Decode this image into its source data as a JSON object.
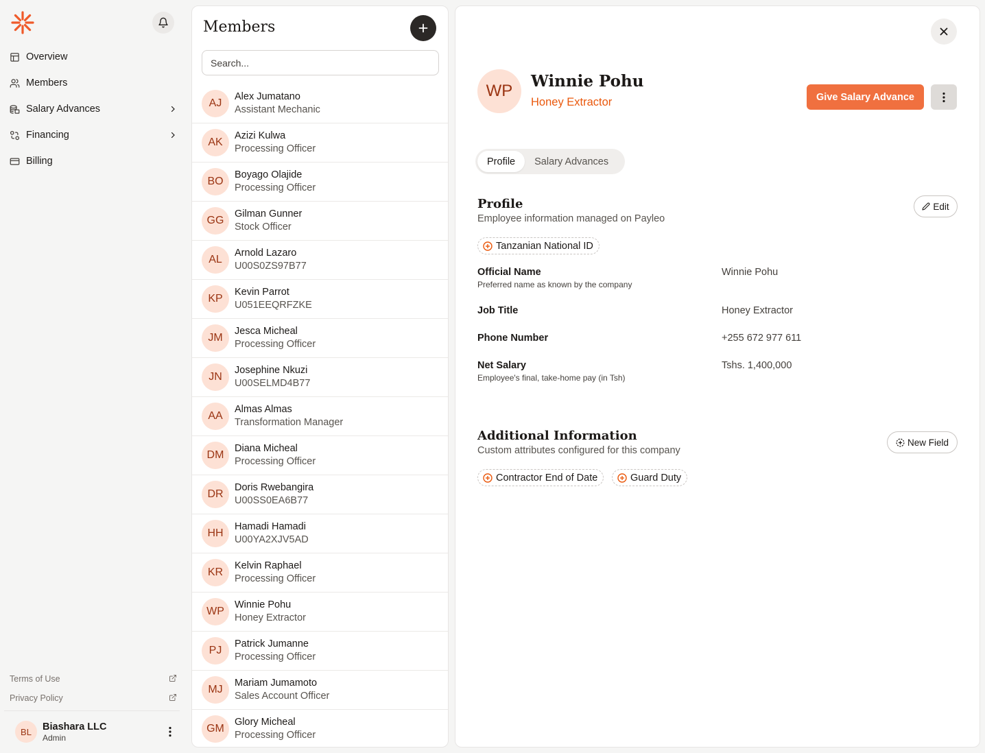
{
  "colors": {
    "accent": "#f0703f",
    "accent_text": "#ea580c",
    "avatar_bg": "#fde1d5",
    "avatar_text": "#9a3412"
  },
  "sidebar": {
    "logo_icon": "asterisk-logo-icon",
    "items": [
      {
        "label": "Overview",
        "icon": "layout-icon",
        "has_chevron": false
      },
      {
        "label": "Members",
        "icon": "users-icon",
        "has_chevron": false
      },
      {
        "label": "Salary Advances",
        "icon": "coins-icon",
        "has_chevron": true
      },
      {
        "label": "Financing",
        "icon": "cycle-icon",
        "has_chevron": true
      },
      {
        "label": "Billing",
        "icon": "credit-card-icon",
        "has_chevron": false
      }
    ],
    "footer_links": [
      {
        "label": "Terms of Use"
      },
      {
        "label": "Privacy Policy"
      }
    ],
    "account": {
      "initials": "BL",
      "name": "Biashara LLC",
      "role": "Admin"
    }
  },
  "members_panel": {
    "title": "Members",
    "search_placeholder": "Search...",
    "members": [
      {
        "initials": "AJ",
        "name": "Alex Jumatano",
        "role": "Assistant Mechanic"
      },
      {
        "initials": "AK",
        "name": "Azizi Kulwa",
        "role": "Processing Officer"
      },
      {
        "initials": "BO",
        "name": "Boyago Olajide",
        "role": "Processing Officer"
      },
      {
        "initials": "GG",
        "name": "Gilman Gunner",
        "role": "Stock Officer"
      },
      {
        "initials": "AL",
        "name": "Arnold Lazaro",
        "role": "U00S0ZS97B77"
      },
      {
        "initials": "KP",
        "name": "Kevin Parrot",
        "role": "U051EEQRFZKE"
      },
      {
        "initials": "JM",
        "name": "Jesca Micheal",
        "role": "Processing Officer"
      },
      {
        "initials": "JN",
        "name": "Josephine Nkuzi",
        "role": "U00SELMD4B77"
      },
      {
        "initials": "AA",
        "name": "Almas Almas",
        "role": "Transformation Manager"
      },
      {
        "initials": "DM",
        "name": "Diana Micheal",
        "role": "Processing Officer"
      },
      {
        "initials": "DR",
        "name": "Doris Rwebangira",
        "role": "U00SS0EA6B77"
      },
      {
        "initials": "HH",
        "name": "Hamadi Hamadi",
        "role": "U00YA2XJV5AD"
      },
      {
        "initials": "KR",
        "name": "Kelvin Raphael",
        "role": "Processing Officer"
      },
      {
        "initials": "WP",
        "name": "Winnie Pohu",
        "role": "Honey Extractor"
      },
      {
        "initials": "PJ",
        "name": "Patrick Jumanne",
        "role": "Processing Officer"
      },
      {
        "initials": "MJ",
        "name": "Mariam Jumamoto",
        "role": "Sales Account Officer"
      },
      {
        "initials": "GM",
        "name": "Glory Micheal",
        "role": "Processing Officer"
      }
    ]
  },
  "detail": {
    "initials": "WP",
    "name": "Winnie Pohu",
    "role": "Honey Extractor",
    "give_advance_label": "Give Salary Advance",
    "tabs": [
      {
        "label": "Profile",
        "active": true
      },
      {
        "label": "Salary Advances",
        "active": false
      }
    ],
    "profile": {
      "title": "Profile",
      "subtitle": "Employee information managed on Payleo",
      "edit_label": "Edit",
      "chip": "Tanzanian National ID",
      "fields": [
        {
          "label": "Official Name",
          "hint": "Preferred name as known by the company",
          "value": "Winnie Pohu"
        },
        {
          "label": "Job Title",
          "hint": "",
          "value": "Honey Extractor"
        },
        {
          "label": "Phone Number",
          "hint": "",
          "value": "+255 672 977 611"
        },
        {
          "label": "Net Salary",
          "hint": "Employee's final, take-home pay (in Tsh)",
          "value": "Tshs. 1,400,000"
        }
      ]
    },
    "additional": {
      "title": "Additional Information",
      "subtitle": "Custom attributes configured for this company",
      "new_field_label": "New Field",
      "chips": [
        "Contractor End of Date",
        "Guard Duty"
      ]
    }
  }
}
